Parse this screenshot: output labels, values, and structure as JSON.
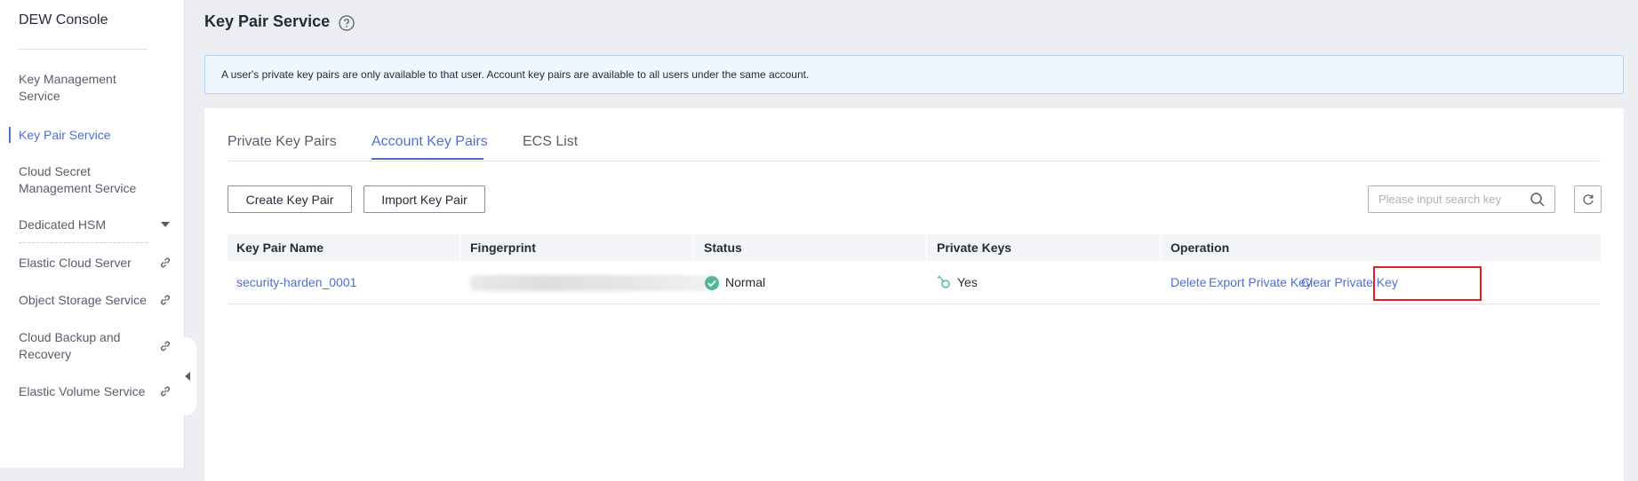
{
  "sidebar": {
    "title": "DEW Console",
    "items": [
      {
        "label": "Key Management Service",
        "active": false
      },
      {
        "label": "Key Pair Service",
        "active": true
      },
      {
        "label": "Cloud Secret Management Service",
        "active": false
      },
      {
        "label": "Dedicated HSM",
        "active": false,
        "icon": "chevron-down-icon"
      },
      {
        "label": "Elastic Cloud Server",
        "active": false,
        "icon": "external-link-icon"
      },
      {
        "label": "Object Storage Service",
        "active": false,
        "icon": "external-link-icon"
      },
      {
        "label": "Cloud Backup and Recovery",
        "active": false,
        "icon": "external-link-icon"
      },
      {
        "label": "Elastic Volume Service",
        "active": false,
        "icon": "external-link-icon"
      }
    ]
  },
  "header": {
    "title": "Key Pair Service",
    "help_icon": "question-circle-icon"
  },
  "notice": {
    "text": "A user's private key pairs are only available to that user. Account key pairs are available to all users under the same account."
  },
  "tabs": [
    {
      "label": "Private Key Pairs",
      "active": false
    },
    {
      "label": "Account Key Pairs",
      "active": true
    },
    {
      "label": "ECS List",
      "active": false
    }
  ],
  "toolbar": {
    "create_label": "Create Key Pair",
    "import_label": "Import Key Pair",
    "search_placeholder": "Please input search key",
    "search_value": ""
  },
  "table": {
    "columns": [
      "Key Pair Name",
      "Fingerprint",
      "Status",
      "Private Keys",
      "Operation"
    ],
    "rows": [
      {
        "name": "security-harden_0001",
        "fingerprint": "",
        "status": "Normal",
        "private_keys": "Yes",
        "operations": [
          "Delete",
          "Export Private Key",
          "Clear Private Key"
        ]
      }
    ]
  },
  "colors": {
    "accent": "#526ecc",
    "status_normal": "#50b98f",
    "highlight": "#e0201f"
  }
}
